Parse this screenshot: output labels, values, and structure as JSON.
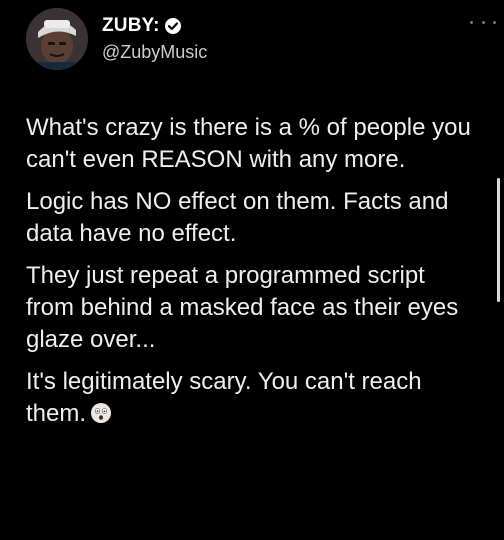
{
  "author": {
    "display_name": "ZUBY:",
    "handle": "@ZubyMusic",
    "verified_icon": "verified-badge-icon",
    "avatar_icon": "profile-avatar"
  },
  "header": {
    "more_icon": "more-options-icon"
  },
  "post": {
    "paragraphs": [
      "What's crazy is there is a % of people you can't even REASON with any more.",
      "Logic has NO effect on them. Facts and data have no effect.",
      "They just repeat a programmed script from behind a masked face as their eyes glaze over...",
      "It's legitimately scary. You can't reach them."
    ],
    "trailing_emoji_icon": "grimacing-face-emoji"
  },
  "colors": {
    "background": "#000000",
    "text": "#e7e9ea",
    "handle": "#c9ccd0"
  }
}
